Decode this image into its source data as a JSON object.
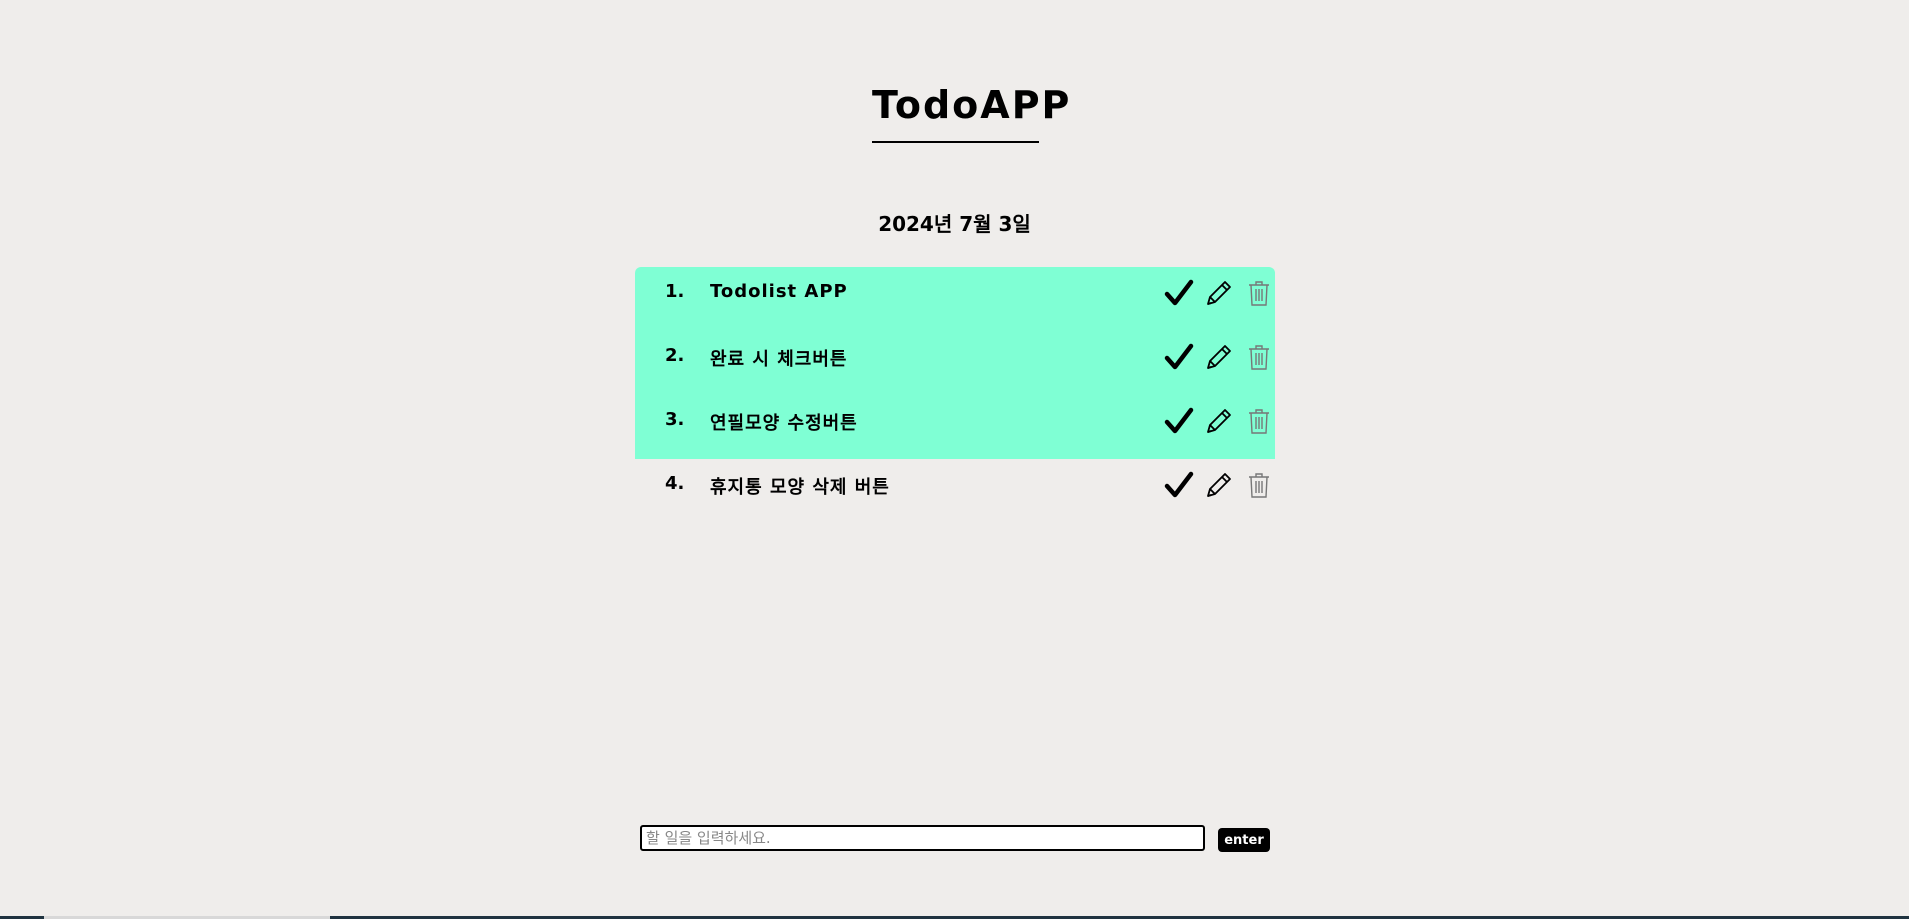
{
  "header": {
    "title": "TodoAPP",
    "date": "2024년 7월 3일"
  },
  "todos": [
    {
      "number": "1.",
      "text": "Todolist APP",
      "done": true
    },
    {
      "number": "2.",
      "text": "완료 시 체크버튼",
      "done": true
    },
    {
      "number": "3.",
      "text": "연필모양 수정버튼",
      "done": true
    },
    {
      "number": "4.",
      "text": "휴지통 모양 삭제 버튼",
      "done": false
    }
  ],
  "icons": {
    "check": "check-icon",
    "edit": "pencil-icon",
    "delete": "trash-icon"
  },
  "input": {
    "placeholder": "할 일을 입력하세요.",
    "value": ""
  },
  "enter_button": {
    "label": "enter"
  },
  "colors": {
    "done_background": "#7fffd4",
    "page_background": "#efedeb"
  }
}
